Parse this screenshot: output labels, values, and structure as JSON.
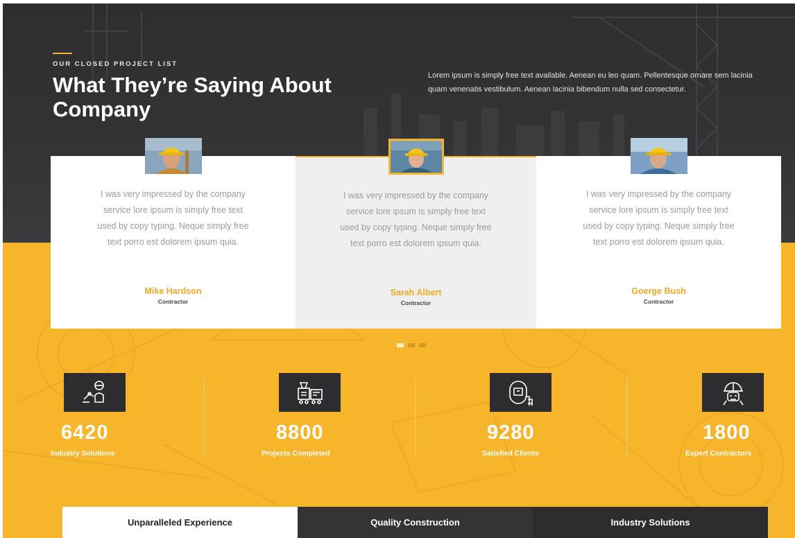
{
  "section": {
    "eyebrow": "OUR CLOSED PROJECT LIST",
    "heading": "What They’re Saying About Company",
    "intro": "Lorem ipsum is simply free text available. Aenean eu leo quam. Pellentesque ornare sem lacinia quam venenatis vestibulum. Aenean lacinia bibendum nulla sed consectetur."
  },
  "testimonials": [
    {
      "quote": "I was very impressed by the company service lore ipsum is simply free text used by copy typing. Neque simply free text porro est dolorem ipsum quia.",
      "name": "Mike Hardson",
      "role": "Contractor"
    },
    {
      "quote": "I was very impressed by the company service lore ipsum is simply free text used by copy typing. Neque simply free text porro est dolorem ipsum quia.",
      "name": "Sarah Albert",
      "role": "Contractor"
    },
    {
      "quote": "I was very impressed by the company service lore ipsum is simply free text used by copy typing. Neque simply free text porro est dolorem ipsum quia.",
      "name": "Goerge Bush",
      "role": "Contractor"
    }
  ],
  "carousel": {
    "pages": 3,
    "active_index": 0
  },
  "stats": [
    {
      "value": "6420",
      "label": "Industry Solutions",
      "icon": "engineer-robot-arm-icon"
    },
    {
      "value": "8800",
      "label": "Projects Completed",
      "icon": "industrial-machine-icon"
    },
    {
      "value": "9280",
      "label": "Satisfied Clients",
      "icon": "electric-plug-icon"
    },
    {
      "value": "1800",
      "label": "Expert Contractors",
      "icon": "worker-helmet-icon"
    }
  ],
  "tabs": [
    {
      "label": "Unparalleled Experience",
      "active": true
    },
    {
      "label": "Quality Construction",
      "active": false
    },
    {
      "label": "Industry Solutions",
      "active": false
    }
  ],
  "colors": {
    "accent": "#f7b52c",
    "dark": "#2d2d2f",
    "name_color": "#f0a923",
    "quote_text": "#9a9a9a"
  }
}
